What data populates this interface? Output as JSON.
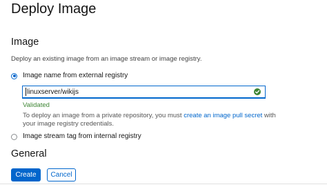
{
  "page": {
    "title": "Deploy Image"
  },
  "image_section": {
    "title": "Image",
    "description": "Deploy an existing image from an image stream or image registry.",
    "option_external": {
      "label": "Image name from external registry",
      "selected": true
    },
    "image_input": {
      "value": "linuxserver/wikijs",
      "validation": "Validated",
      "valid_icon": "check-circle-icon"
    },
    "help": {
      "prefix": "To deploy an image from a private repository, you must ",
      "link": "create an image pull secret",
      "suffix": " with your image registry credentials."
    },
    "option_internal": {
      "label": "Image stream tag from internal registry",
      "selected": false
    }
  },
  "general_section": {
    "title": "General"
  },
  "actions": {
    "create_label": "Create",
    "cancel_label": "Cancel"
  },
  "colors": {
    "primary": "#0066cc",
    "success": "#3e8635"
  }
}
